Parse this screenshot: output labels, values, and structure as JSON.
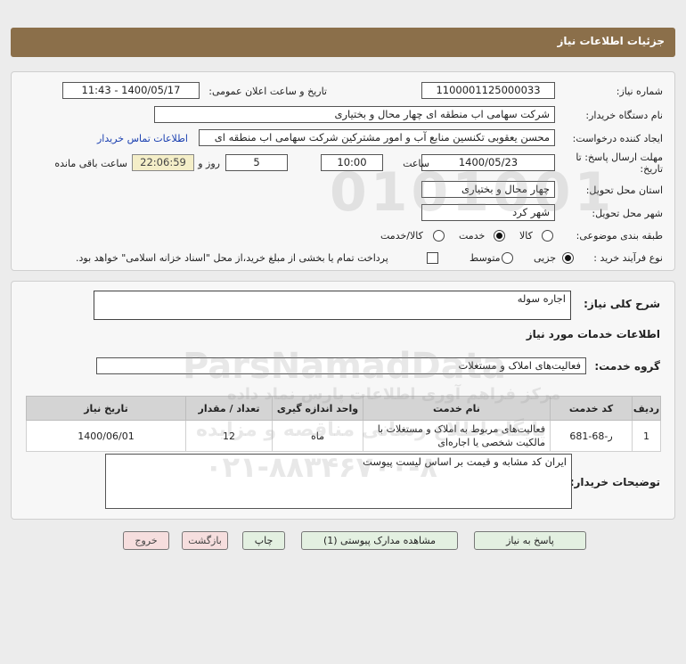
{
  "header": {
    "title": "جزئیات اطلاعات نیاز"
  },
  "info": {
    "need_number_label": "شماره نیاز:",
    "need_number": "1100001125000033",
    "announce_label": "تاریخ و ساعت اعلان عمومی:",
    "announce_value": "1400/05/17 - 11:43",
    "buyer_org_label": "نام دستگاه خریدار:",
    "buyer_org": "شرکت سهامی اب منطقه ای چهار محال و بختیاری",
    "creator_label": "ایجاد کننده درخواست:",
    "creator": "محسن یعقوبی تکنسین منابع آب و امور مشترکین شرکت سهامی اب منطقه ای",
    "contact_link": "اطلاعات تماس خریدار",
    "deadline_label_1": "مهلت ارسال پاسخ: تا",
    "deadline_label_2": "تاریخ:",
    "deadline_date": "1400/05/23",
    "time_label": "ساعت",
    "deadline_time": "10:00",
    "days_value": "5",
    "days_label": "روز و",
    "remaining_time": "22:06:59",
    "remaining_label": "ساعت باقی مانده",
    "province_label": "استان محل تحویل:",
    "province": "چهار محال و بختیاری",
    "city_label": "شهر محل تحویل:",
    "city": "شهر کرد",
    "category_label": "طبقه بندی موضوعی:",
    "category_options": [
      "کالا",
      "خدمت",
      "کالا/خدمت"
    ],
    "category_selected": "خدمت",
    "process_label": "نوع فرآیند خرید :",
    "process_options": [
      "جزیی",
      "متوسط"
    ],
    "process_selected": "جزیی",
    "payment_note": "پرداخت تمام یا بخشی از مبلغ خرید،از محل \"اسناد خزانه اسلامی\" خواهد بود."
  },
  "details": {
    "summary_label": "شرح کلی نیاز:",
    "summary": "اجاره سوله",
    "services_heading": "اطلاعات خدمات مورد نیاز",
    "service_group_label": "گروه خدمت:",
    "service_group": "فعالیت‌های  املاک و مستغلات",
    "table": {
      "headers": [
        "ردیف",
        "کد خدمت",
        "نام خدمت",
        "واحد اندازه گیری",
        "تعداد / مقدار",
        "تاریخ نیاز"
      ],
      "rows": [
        [
          "1",
          "ر-68-681",
          "فعالیت‌های مربوط به املاک و مستغلات با مالکیت شخصی یا اجاره‌ای",
          "ماه",
          "12",
          "1400/06/01"
        ]
      ]
    },
    "buyer_notes_label": "توضیحات خریدار:",
    "buyer_notes": "ایران کد مشابه و قیمت بر اساس لیست پیوست"
  },
  "buttons": {
    "reply": "پاسخ به نیاز",
    "view_docs": "مشاهده مدارک پیوستی (1)",
    "print": "چاپ",
    "back": "بازگشت",
    "exit": "خروج"
  },
  "watermark": {
    "brand": "ParsNamadData",
    "tagline": "مرکز فراهم آوری اطلاعات پارس نماد داده",
    "subtitle": "پایگاه اطلاع رسانی مناقصه و مزایده",
    "phone": "۰۲۱-۸۸۳۴۶۷۰۰-۸",
    "digits": "0101001"
  },
  "colors": {
    "header_bg": "#8b6f4a",
    "button_bg": "#e3f0e1",
    "button_alt_bg": "#f6dede",
    "remaining_bg": "#f4eec8",
    "link": "#1a3fb0"
  }
}
